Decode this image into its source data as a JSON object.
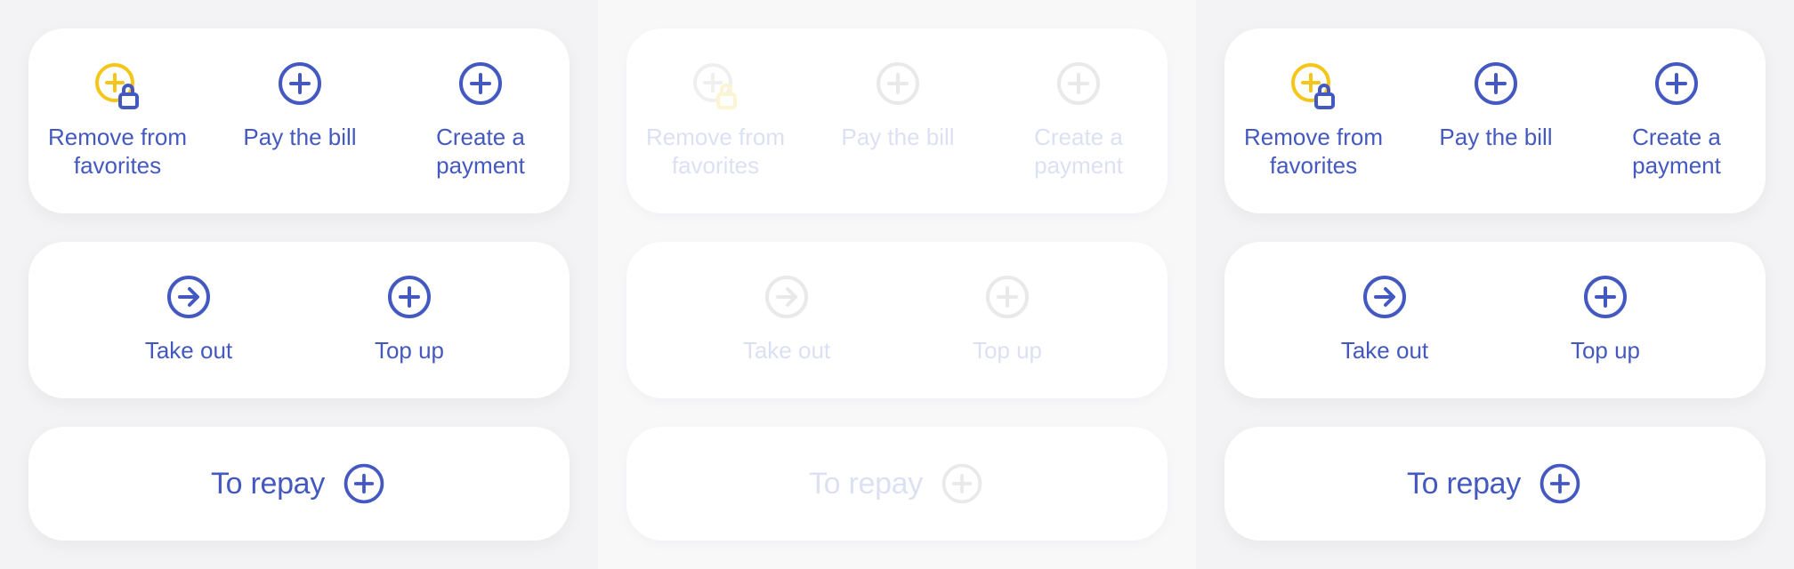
{
  "colors": {
    "accent": "#4459c0",
    "favorite": "#f5c518",
    "card": "#ffffff",
    "background": "#f3f3f5"
  },
  "panels": [
    {
      "state": "normal",
      "actions": [
        {
          "label": "Remove from\nfavorites",
          "icon": "add-favorite-lock-icon"
        },
        {
          "label": "Pay the bill",
          "icon": "plus-circle-icon"
        },
        {
          "label": "Create a\npayment",
          "icon": "plus-circle-icon"
        }
      ],
      "transfer": [
        {
          "label": "Take out",
          "icon": "arrow-right-circle-icon"
        },
        {
          "label": "Top up",
          "icon": "plus-circle-icon"
        }
      ],
      "repay": {
        "label": "To repay",
        "icon": "plus-circle-icon"
      }
    },
    {
      "state": "disabled",
      "actions": [
        {
          "label": "Remove from\nfavorites",
          "icon": "add-favorite-lock-icon"
        },
        {
          "label": "Pay the bill",
          "icon": "plus-circle-icon"
        },
        {
          "label": "Create a\npayment",
          "icon": "plus-circle-icon"
        }
      ],
      "transfer": [
        {
          "label": "Take out",
          "icon": "arrow-right-circle-icon"
        },
        {
          "label": "Top up",
          "icon": "plus-circle-icon"
        }
      ],
      "repay": {
        "label": "To repay",
        "icon": "plus-circle-icon"
      }
    },
    {
      "state": "normal",
      "actions": [
        {
          "label": "Remove from\nfavorites",
          "icon": "add-favorite-lock-icon"
        },
        {
          "label": "Pay the bill",
          "icon": "plus-circle-icon"
        },
        {
          "label": "Create a\npayment",
          "icon": "plus-circle-icon"
        }
      ],
      "transfer": [
        {
          "label": "Take out",
          "icon": "arrow-right-circle-icon"
        },
        {
          "label": "Top up",
          "icon": "plus-circle-icon"
        }
      ],
      "repay": {
        "label": "To repay",
        "icon": "plus-circle-icon"
      }
    }
  ]
}
